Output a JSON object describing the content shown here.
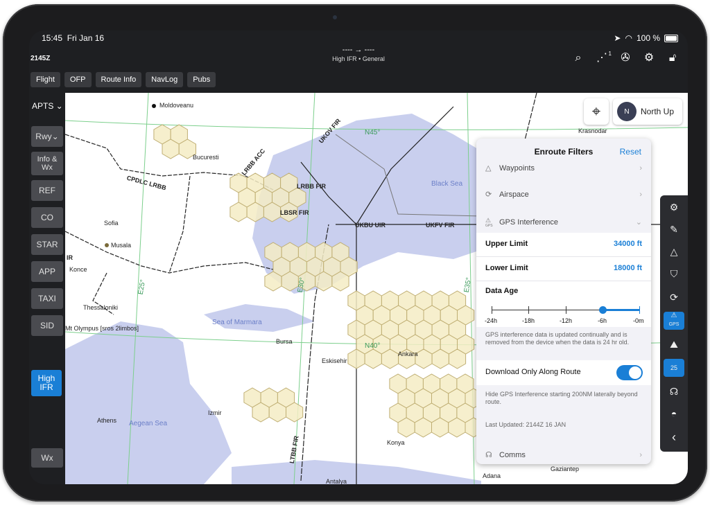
{
  "status_bar": {
    "time": "15:45",
    "date": "Fri Jan 16",
    "battery": "100 %"
  },
  "header": {
    "zulu": "2145Z",
    "route": "----  →  ----",
    "subtitle": "High IFR • General",
    "route_badge": "1"
  },
  "tabs": [
    "Flight",
    "OFP",
    "Route Info",
    "NavLog",
    "Pubs"
  ],
  "sidebar": {
    "apts": "APTS",
    "items": [
      "Rwy",
      "Info & Wx",
      "REF",
      "CO",
      "STAR",
      "APP",
      "TAXI",
      "SID"
    ],
    "chart_mode": "High IFR",
    "wx": "Wx"
  },
  "map": {
    "north_up": "North Up",
    "compass": "N",
    "labels": [
      {
        "text": "Moldoveanu",
        "kind": "city"
      },
      {
        "text": "Bucuresti",
        "kind": "city"
      },
      {
        "text": "Krasnodar",
        "kind": "city"
      },
      {
        "text": "Sofia",
        "kind": "city"
      },
      {
        "text": "Musala",
        "kind": "city"
      },
      {
        "text": "Konce",
        "kind": "city"
      },
      {
        "text": "Thessaloniki",
        "kind": "city"
      },
      {
        "text": "Mt Olympus [sros 2limbos]",
        "kind": "city"
      },
      {
        "text": "Bursa",
        "kind": "city"
      },
      {
        "text": "Eskisehir",
        "kind": "city"
      },
      {
        "text": "Ankara",
        "kind": "city"
      },
      {
        "text": "Izmir",
        "kind": "city"
      },
      {
        "text": "Athens",
        "kind": "city"
      },
      {
        "text": "Konya",
        "kind": "city"
      },
      {
        "text": "Antalya",
        "kind": "city"
      },
      {
        "text": "Adana",
        "kind": "city"
      },
      {
        "text": "Gaziantep",
        "kind": "city"
      },
      {
        "text": "Black Sea",
        "kind": "water"
      },
      {
        "text": "Sea of Marmara",
        "kind": "water"
      },
      {
        "text": "Aegean Sea",
        "kind": "water"
      },
      {
        "text": "N45°",
        "kind": "grid"
      },
      {
        "text": "N40°",
        "kind": "grid"
      },
      {
        "text": "E30°",
        "kind": "grid"
      },
      {
        "text": "E35°",
        "kind": "grid"
      },
      {
        "text": "E25°",
        "kind": "grid"
      },
      {
        "text": "UKOV FIR",
        "kind": "fir"
      },
      {
        "text": "LRBB ACC",
        "kind": "fir"
      },
      {
        "text": "CPDLC LRBB",
        "kind": "fir"
      },
      {
        "text": "LRBB FIR",
        "kind": "fir"
      },
      {
        "text": "LBSR FIR",
        "kind": "fir"
      },
      {
        "text": "UKBU UIR",
        "kind": "fir"
      },
      {
        "text": "UKFV FIR",
        "kind": "fir"
      },
      {
        "text": "LTBB FIR",
        "kind": "fir"
      },
      {
        "text": "IR",
        "kind": "fir"
      }
    ]
  },
  "panel": {
    "title": "Enroute Filters",
    "reset": "Reset",
    "waypoints": "Waypoints",
    "airspace": "Airspace",
    "gps_interference": "GPS Interference",
    "gps_tag": "GPS",
    "upper_limit_label": "Upper Limit",
    "upper_limit_value": "34000 ft",
    "lower_limit_label": "Lower Limit",
    "lower_limit_value": "18000 ft",
    "data_age_label": "Data Age",
    "data_age_ticks": [
      "-24h",
      "-18h",
      "-12h",
      "-6h",
      "-0m"
    ],
    "data_age_selected_start_index": 3,
    "data_note": "GPS interference data is updated continually and is removed from the device when the data is 24 hr old.",
    "download_label": "Download Only Along Route",
    "download_on": true,
    "route_note": "Hide GPS Interference starting 200NM laterally beyond route.",
    "last_updated": "Last Updated: 2144Z 16 JAN",
    "comms": "Comms"
  },
  "right_toolbar": {
    "items": [
      "gear-icon",
      "pen-icon",
      "triangle-icon",
      "shield-icon",
      "airspace-icon",
      "gps-warning-icon",
      "terrain-icon",
      "altitude-icon",
      "headphones-icon",
      "dome-icon",
      "collapse-icon"
    ],
    "gps_label": "GPS",
    "altitude_label": "25"
  },
  "colors": {
    "accent": "#1a7fd6",
    "water": "#c9cfee",
    "hex": "#f4ecc4",
    "hex_stroke": "#bfae73",
    "gridline": "#7ccf8c"
  }
}
